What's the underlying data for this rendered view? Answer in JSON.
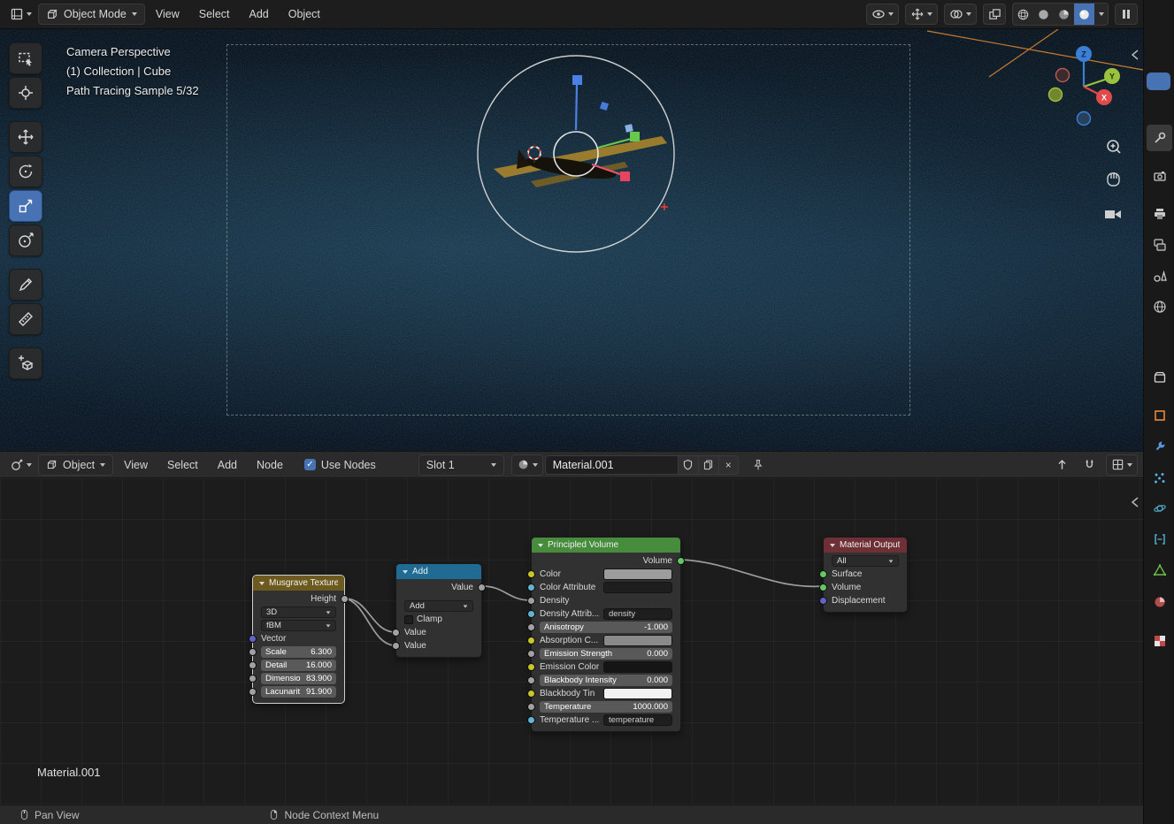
{
  "colors": {
    "accent": "#4772b3",
    "wire": "#9d9d9d",
    "orange_wire": "#d4802f",
    "node_header_texture": "#6d5a1f",
    "node_header_converter": "#1f6b93",
    "node_header_shader": "#468c3c",
    "node_header_output": "#6e2f36",
    "socket_value": "#a1a1a1",
    "socket_vector": "#6363c7",
    "socket_color": "#c7c729",
    "socket_shader": "#63c763",
    "socket_string": "#63b3d4",
    "swatch_color": "#9c9c9c",
    "swatch_color_attribute": "#1f1f1f",
    "swatch_absorption": "#8a8a8a",
    "swatch_emission": "#151515",
    "swatch_blackbody_tint": "#f2f2f2"
  },
  "viewport_header": {
    "mode": "Object Mode",
    "menus": [
      "View",
      "Select",
      "Add",
      "Object"
    ]
  },
  "viewport": {
    "overlay": [
      "Camera Perspective",
      "(1) Collection | Cube",
      "Path Tracing Sample 5/32"
    ],
    "axis": {
      "x": "X",
      "y": "Y",
      "z": "Z"
    }
  },
  "shader_header": {
    "id_type": "Object",
    "menus": [
      "View",
      "Select",
      "Add",
      "Node"
    ],
    "use_nodes": "Use Nodes",
    "slot": "Slot 1",
    "material_name": "Material.001"
  },
  "nodes": {
    "musgrave": {
      "title": "Musgrave Texture",
      "output": "Height",
      "dimensions": "3D",
      "musgrave_type": "fBM",
      "vector": "Vector",
      "fields": [
        {
          "label": "Scale",
          "value": "6.300"
        },
        {
          "label": "Detail",
          "value": "16.000"
        },
        {
          "label": "Dimensio",
          "value": "83.900"
        },
        {
          "label": "Lacunarit",
          "value": "91.900"
        }
      ]
    },
    "math": {
      "title": "Add",
      "output": "Value",
      "operation": "Add",
      "clamp": "Clamp",
      "inputs": [
        "Value",
        "Value"
      ]
    },
    "volume": {
      "title": "Principled Volume",
      "output": "Volume",
      "color": "Color",
      "color_attribute": "Color Attribute",
      "density": "Density",
      "density_attribute": "Density Attrib...",
      "density_attribute_value": "density",
      "anisotropy": "Anisotropy",
      "anisotropy_value": "-1.000",
      "absorption_color": "Absorption C...",
      "emission_strength": "Emission Strength",
      "emission_strength_value": "0.000",
      "emission_color": "Emission Color",
      "blackbody_intensity": "Blackbody Intensity",
      "blackbody_intensity_value": "0.000",
      "blackbody_tint": "Blackbody Tin",
      "temperature": "Temperature",
      "temperature_value": "1000.000",
      "temperature_attribute": "Temperature ...",
      "temperature_attribute_value": "temperature"
    },
    "output_node": {
      "title": "Material Output",
      "target": "All",
      "inputs": [
        "Surface",
        "Volume",
        "Displacement"
      ]
    }
  },
  "node_editor": {
    "breadcrumb": "Material.001"
  },
  "status_bar": {
    "items": [
      "Pan View",
      "Node Context Menu"
    ]
  }
}
